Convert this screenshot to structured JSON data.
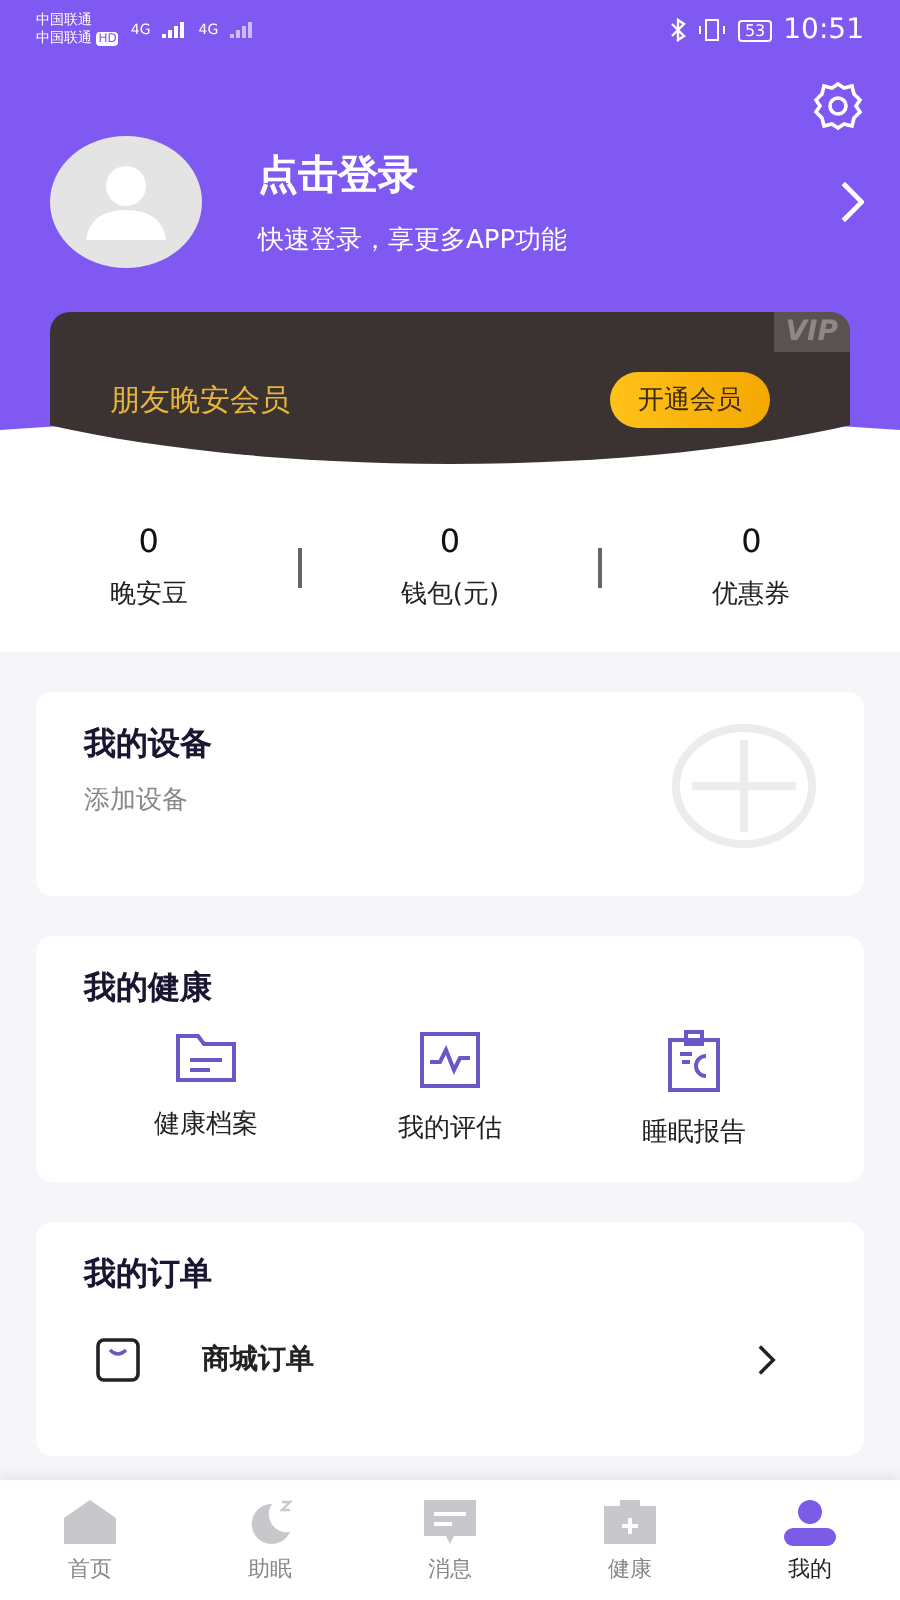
{
  "status_bar": {
    "carriers": [
      "中国联通",
      "中国联通"
    ],
    "hd": "HD",
    "network": [
      "4G",
      "4G"
    ],
    "battery": "53",
    "time": "10:51"
  },
  "profile": {
    "title": "点击登录",
    "subtitle": "快速登录，享更多APP功能"
  },
  "vip": {
    "badge": "VIP",
    "title": "朋友晚安会员",
    "button": "开通会员"
  },
  "stats": [
    {
      "value": "0",
      "label": "晚安豆"
    },
    {
      "value": "0",
      "label": "钱包(元)"
    },
    {
      "value": "0",
      "label": "优惠券"
    }
  ],
  "devices": {
    "title": "我的设备",
    "subtitle": "添加设备"
  },
  "health": {
    "title": "我的健康",
    "items": [
      {
        "kind": "folder",
        "label": "健康档案"
      },
      {
        "kind": "pulse",
        "label": "我的评估"
      },
      {
        "kind": "report",
        "label": "睡眠报告"
      }
    ]
  },
  "orders": {
    "title": "我的订单",
    "items": [
      {
        "kind": "bag",
        "label": "商城订单"
      }
    ]
  },
  "tab_bar": [
    {
      "kind": "home",
      "label": "首页",
      "selected": false
    },
    {
      "kind": "moon",
      "label": "助眠",
      "selected": false
    },
    {
      "kind": "message",
      "label": "消息",
      "selected": false
    },
    {
      "kind": "kit",
      "label": "健康",
      "selected": false
    },
    {
      "kind": "person",
      "label": "我的",
      "selected": true
    }
  ]
}
